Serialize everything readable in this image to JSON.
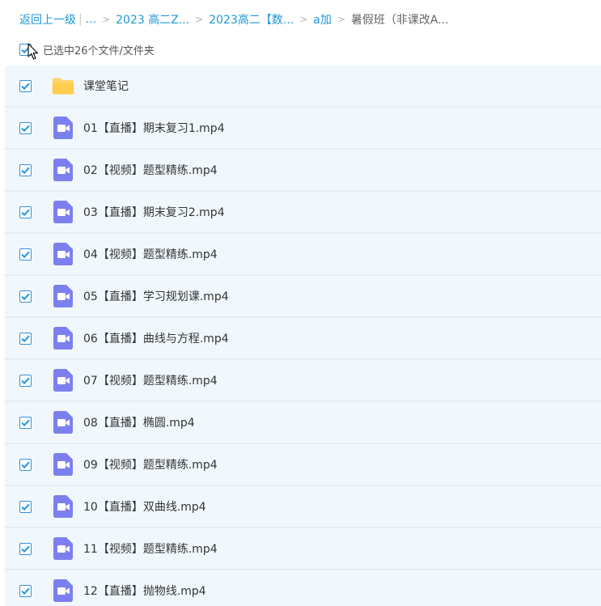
{
  "breadcrumb": {
    "back": "返回上一级",
    "ellipsis": "...",
    "items": [
      "2023 高二Z...",
      "2023高二【数...",
      "a加"
    ],
    "current": "暑假班（非课改A..."
  },
  "selection": {
    "label": "已选中26个文件/文件夹"
  },
  "colors": {
    "accent": "#1e98d7",
    "row_bg": "#f1f8fd",
    "video_icon": "#7c80ee",
    "folder_icon": "#ffd46b"
  },
  "files": [
    {
      "name": "课堂笔记",
      "type": "folder",
      "checked": true
    },
    {
      "name": "01【直播】期末复习1.mp4",
      "type": "video",
      "checked": true
    },
    {
      "name": "02【视频】题型精练.mp4",
      "type": "video",
      "checked": true
    },
    {
      "name": "03【直播】期末复习2.mp4",
      "type": "video",
      "checked": true
    },
    {
      "name": "04【视频】题型精练.mp4",
      "type": "video",
      "checked": true
    },
    {
      "name": "05【直播】学习规划课.mp4",
      "type": "video",
      "checked": true
    },
    {
      "name": "06【直播】曲线与方程.mp4",
      "type": "video",
      "checked": true
    },
    {
      "name": "07【视频】题型精练.mp4",
      "type": "video",
      "checked": true
    },
    {
      "name": "08【直播】椭圆.mp4",
      "type": "video",
      "checked": true
    },
    {
      "name": "09【视频】题型精练.mp4",
      "type": "video",
      "checked": true
    },
    {
      "name": "10【直播】双曲线.mp4",
      "type": "video",
      "checked": true
    },
    {
      "name": "11【视频】题型精练.mp4",
      "type": "video",
      "checked": true
    },
    {
      "name": "12【直播】抛物线.mp4",
      "type": "video",
      "checked": true
    }
  ]
}
